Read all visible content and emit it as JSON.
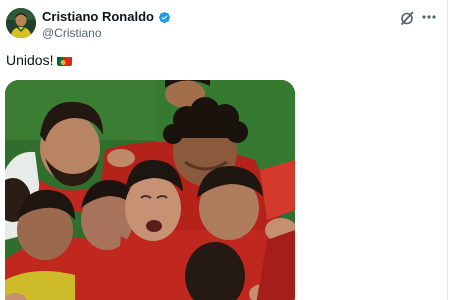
{
  "post": {
    "author": {
      "display_name": "Cristiano Ronaldo",
      "handle": "@Cristiano",
      "verified": true,
      "avatar_icon": "avatar-photo"
    },
    "text": "Unidos!",
    "text_emoji": "portugal-flag-icon",
    "media": {
      "type": "photo",
      "icon": "team-celebration-photo"
    },
    "actions": {
      "grok_icon": "grok-icon",
      "more_icon": "more-icon"
    }
  },
  "colors": {
    "name_text": "#0f1419",
    "secondary_text": "#536471",
    "verified_badge": "#1d9bf0",
    "flag_green": "#046a38",
    "flag_red": "#da291c",
    "jersey_red": "#c0281f",
    "pitch_green": "#2f6e2c"
  }
}
